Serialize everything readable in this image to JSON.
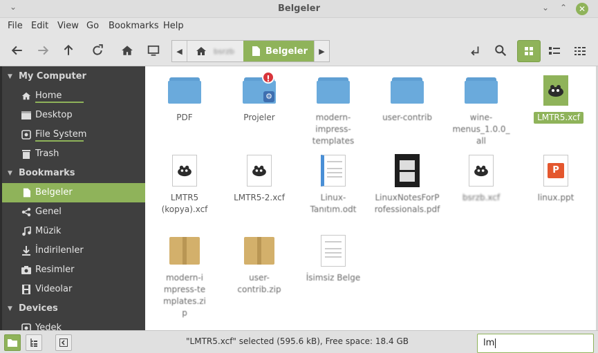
{
  "window": {
    "title": "Belgeler"
  },
  "menu": [
    "File",
    "Edit",
    "View",
    "Go",
    "Bookmarks",
    "Help"
  ],
  "breadcrumb": {
    "segments": [
      "bsrzb",
      "Belgeler"
    ],
    "active_index": 1
  },
  "sidebar": {
    "sections": [
      {
        "title": "My Computer",
        "items": [
          {
            "label": "Home",
            "icon": "home-icon"
          },
          {
            "label": "Desktop",
            "icon": "desktop-icon"
          },
          {
            "label": "File System",
            "icon": "drive-icon"
          },
          {
            "label": "Trash",
            "icon": "trash-icon"
          }
        ]
      },
      {
        "title": "Bookmarks",
        "items": [
          {
            "label": "Belgeler",
            "icon": "document-icon",
            "selected": true
          },
          {
            "label": "Genel",
            "icon": "share-icon"
          },
          {
            "label": "Müzik",
            "icon": "music-icon"
          },
          {
            "label": "İndirilenler",
            "icon": "download-icon"
          },
          {
            "label": "Resimler",
            "icon": "camera-icon"
          },
          {
            "label": "Videolar",
            "icon": "film-icon"
          }
        ]
      },
      {
        "title": "Devices",
        "items": [
          {
            "label": "Yedek",
            "icon": "drive-icon"
          }
        ]
      }
    ]
  },
  "files": [
    {
      "name": "PDF",
      "type": "folder"
    },
    {
      "name": "Projeler",
      "type": "folder-emblem"
    },
    {
      "name": "modern-impress-templates",
      "type": "folder"
    },
    {
      "name": "user-contrib",
      "type": "folder"
    },
    {
      "name": "wine-menus_1.0.0_all",
      "type": "folder"
    },
    {
      "name": "LMTR5.xcf",
      "type": "xcf",
      "selected": true
    },
    {
      "name": "LMTR5 (kopya).xcf",
      "type": "xcf"
    },
    {
      "name": "LMTR5-2.xcf",
      "type": "xcf"
    },
    {
      "name": "Linux-Tanıtım.odt",
      "type": "odt"
    },
    {
      "name": "LinuxNotesForProfessionals.pdf",
      "type": "pdf"
    },
    {
      "name": "bsrzb.xcf",
      "type": "xcf"
    },
    {
      "name": "linux.ppt",
      "type": "ppt"
    },
    {
      "name": "modern-impress-templates.zip",
      "type": "zip"
    },
    {
      "name": "user-contrib.zip",
      "type": "zip"
    },
    {
      "name": "İsimsiz Belge",
      "type": "text"
    }
  ],
  "status": {
    "text": "\"LMTR5.xcf\" selected (595.6 kB), Free space: 18.4 GB"
  },
  "search": {
    "value": "lm"
  },
  "colors": {
    "accent": "#8fb35a",
    "sidebar_bg": "#3f3f3f",
    "folder": "#6aaadc"
  }
}
